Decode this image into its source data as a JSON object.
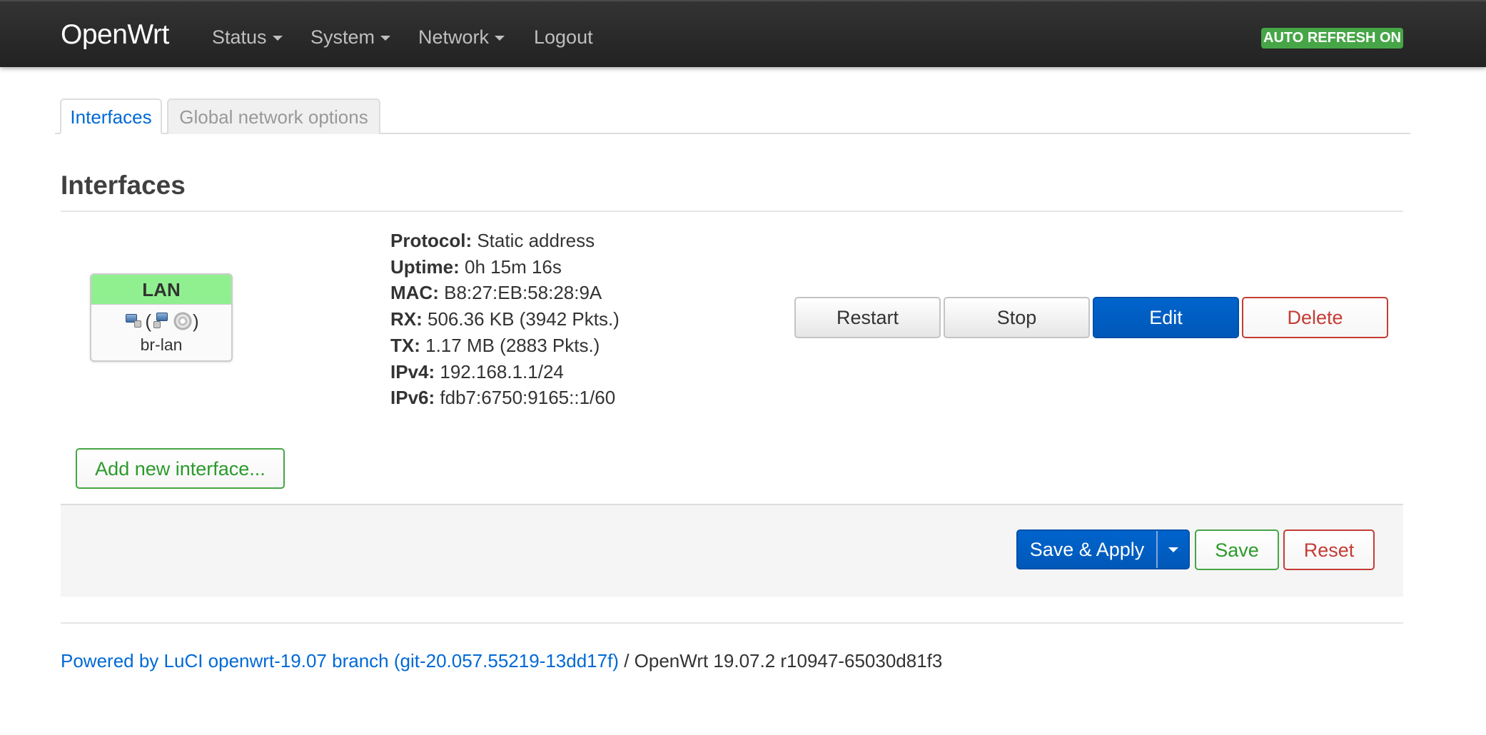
{
  "navbar": {
    "brand": "OpenWrt",
    "menu": [
      {
        "label": "Status"
      },
      {
        "label": "System"
      },
      {
        "label": "Network"
      },
      {
        "label": "Logout"
      }
    ],
    "auto_refresh": "AUTO REFRESH ON",
    "auto_refresh_color": "#46a546"
  },
  "tabs": [
    {
      "label": "Interfaces",
      "active": true
    },
    {
      "label": "Global network options",
      "active": false
    }
  ],
  "section": {
    "title": "Interfaces"
  },
  "interface": {
    "name": "LAN",
    "name_color": "#90f090",
    "icons_open": "(",
    "icons_close": ")",
    "icons": [
      "ethernet-port-icon",
      "ethernet-port-icon",
      "wireless-icon"
    ],
    "device": "br-lan",
    "details": [
      {
        "label": "Protocol:",
        "value": "Static address"
      },
      {
        "label": "Uptime:",
        "value": "0h 15m 16s"
      },
      {
        "label": "MAC:",
        "value": "B8:27:EB:58:28:9A"
      },
      {
        "label": "RX:",
        "value": "506.36 KB (3942 Pkts.)"
      },
      {
        "label": "TX:",
        "value": "1.17 MB (2883 Pkts.)"
      },
      {
        "label": "IPv4:",
        "value": "192.168.1.1/24"
      },
      {
        "label": "IPv6:",
        "value": "fdb7:6750:9165::1/60"
      }
    ],
    "actions": {
      "restart": "Restart",
      "stop": "Stop",
      "edit": "Edit",
      "delete": "Delete"
    }
  },
  "add_interface": "Add new interface...",
  "action_bar": {
    "save_apply": "Save & Apply",
    "save": "Save",
    "reset": "Reset"
  },
  "footer": {
    "link_text": "Powered by LuCI openwrt-19.07 branch (git-20.057.55219-13dd17f)",
    "separator": " / ",
    "version": "OpenWrt 19.07.2 r10947-65030d81f3"
  },
  "colors": {
    "primary": "#0064cd",
    "danger": "#c43c35",
    "success": "#46a546",
    "link": "#0069d6"
  }
}
